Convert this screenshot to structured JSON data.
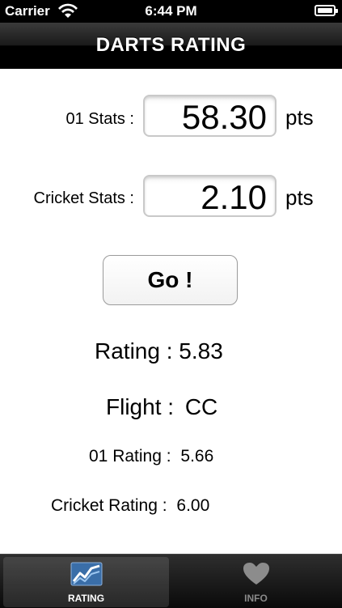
{
  "status_bar": {
    "carrier": "Carrier",
    "time": "6:44 PM"
  },
  "nav": {
    "title": "DARTS RATING"
  },
  "inputs": {
    "o1_label": "01 Stats :",
    "o1_value": "58.30",
    "o1_unit": "pts",
    "cricket_label": "Cricket Stats :",
    "cricket_value": "2.10",
    "cricket_unit": "pts"
  },
  "go_label": "Go !",
  "results": {
    "rating_label": "Rating :",
    "rating_value": "5.83",
    "flight_label": "Flight :",
    "flight_value": "CC",
    "o1_rating_label": "01 Rating :",
    "o1_rating_value": "5.66",
    "cricket_rating_label": "Cricket Rating :",
    "cricket_rating_value": "6.00"
  },
  "tabs": [
    {
      "label": "RATING",
      "icon": "chart-icon",
      "active": true
    },
    {
      "label": "INFO",
      "icon": "heart-icon",
      "active": false
    }
  ]
}
